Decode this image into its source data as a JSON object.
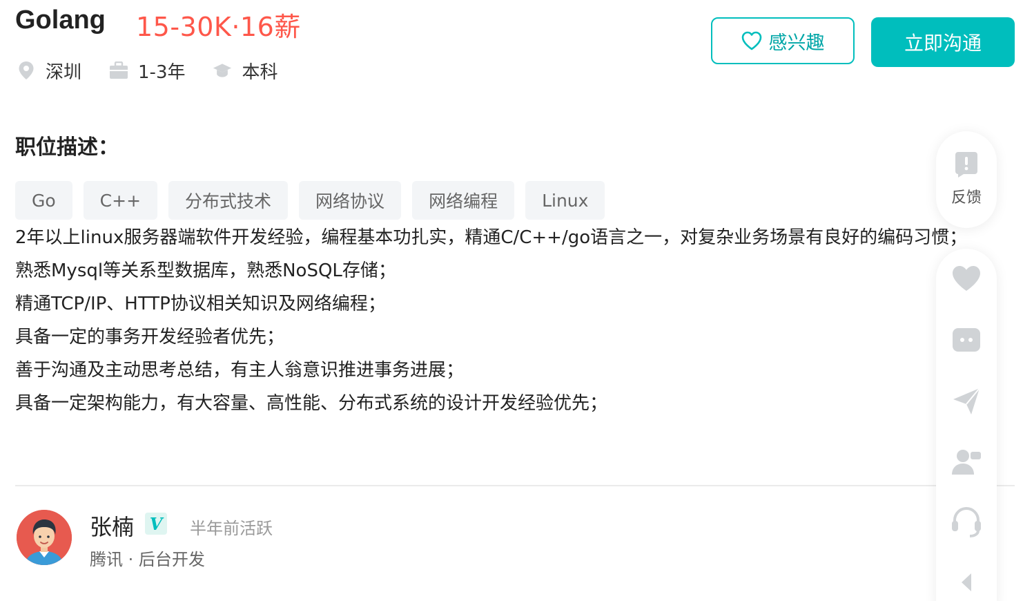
{
  "job": {
    "title": "Golang",
    "salary": "15-30K·16薪",
    "location": "深圳",
    "experience": "1-3年",
    "education": "本科"
  },
  "actions": {
    "interest_label": "感兴趣",
    "chat_label": "立即沟通"
  },
  "description": {
    "heading": "职位描述：",
    "tags": [
      "Go",
      "C++",
      "分布式技术",
      "网络协议",
      "网络编程",
      "Linux"
    ],
    "lines": [
      "2年以上linux服务器端软件开发经验，编程基本功扎实，精通C/C++/go语言之一，对复杂业务场景有良好的编码习惯；",
      "熟悉Mysql等关系型数据库，熟悉NoSQL存储；",
      "精通TCP/IP、HTTP协议相关知识及网络编程；",
      "具备一定的事务开发经验者优先；",
      "善于沟通及主动思考总结，有主人翁意识推进事务进展；",
      "具备一定架构能力，有大容量、高性能、分布式系统的设计开发经验优先；"
    ]
  },
  "recruiter": {
    "name": "张楠",
    "verified_mark": "V",
    "active": "半年前活跃",
    "company": "腾讯 · 后台开发"
  },
  "sidebar": {
    "feedback_label": "反馈",
    "icons": [
      "feedback-icon",
      "heart-icon",
      "chat-bubble-icon",
      "send-icon",
      "contact-icon",
      "headset-icon",
      "collapse-icon"
    ]
  },
  "colors": {
    "accent": "#00bebd",
    "salary": "#fe574a",
    "icon_gray": "#d0d3d6"
  }
}
